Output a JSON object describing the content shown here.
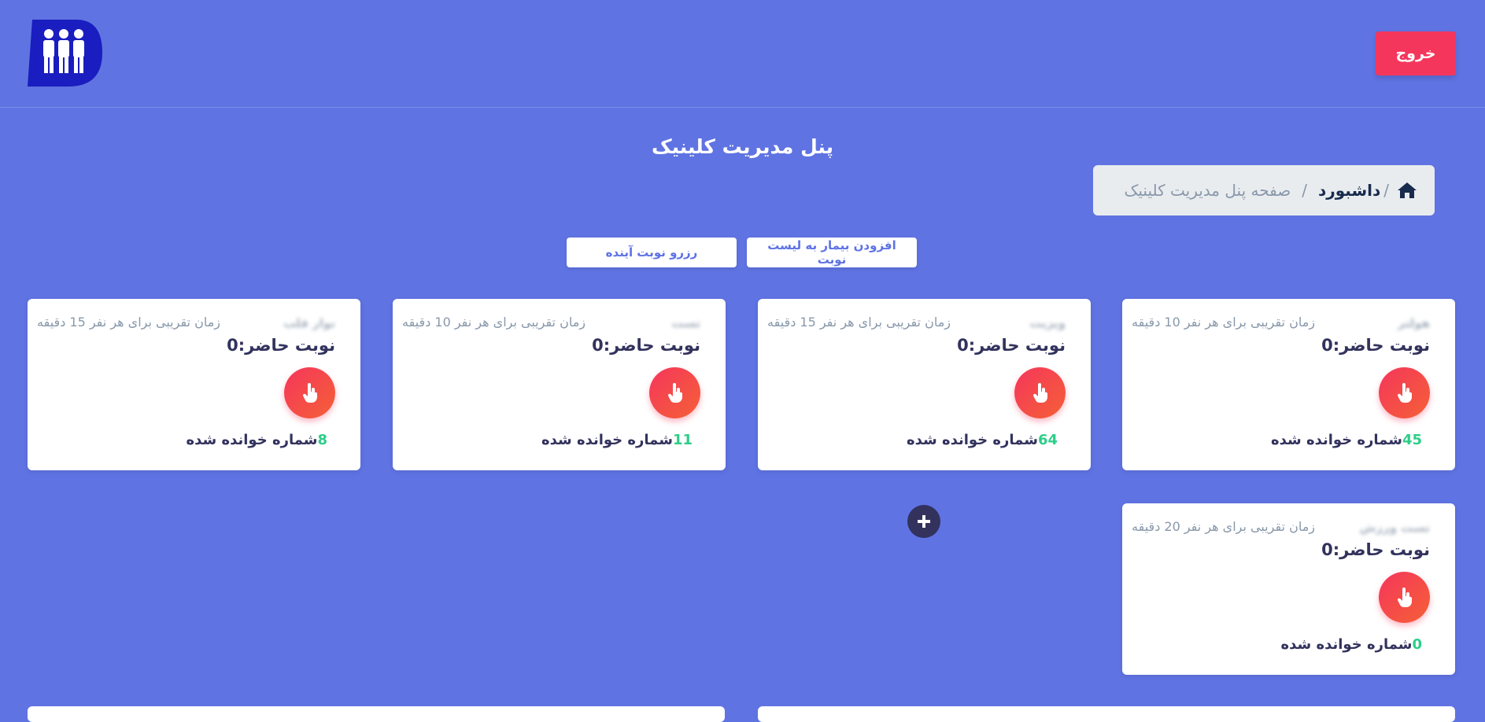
{
  "header": {
    "logo": "clinic-people-logo",
    "logout_label": "خروج"
  },
  "page_title": "پنل مدیریت کلینیک",
  "breadcrumb": {
    "home_icon": "home-icon",
    "separator": "/",
    "current": "داشبورد",
    "page": "صفحه پنل مدیریت کلینیک"
  },
  "actions": {
    "add_patient": "افزودن بیمار به لیست نوبت",
    "reserve": "رزرو نوبت آینده"
  },
  "cards": [
    {
      "name": "هولتر",
      "time": "زمان تقریبی برای هر نفر 10 دقیقه",
      "current": "نوبت حاضر:0",
      "called_count": "45",
      "called_label": "شماره خوانده شده"
    },
    {
      "name": "ویزیت",
      "time": "زمان تقریبی برای هر نفر 15 دقیقه",
      "current": "نوبت حاضر:0",
      "called_count": "64",
      "called_label": "شماره خوانده شده"
    },
    {
      "name": "تست",
      "time": "زمان تقریبی برای هر نفر 10 دقیقه",
      "current": "نوبت حاضر:0",
      "called_count": "11",
      "called_label": "شماره خوانده شده"
    },
    {
      "name": "نوار قلب",
      "time": "زمان تقریبی برای هر نفر 15 دقیقه",
      "current": "نوبت حاضر:0",
      "called_count": "8",
      "called_label": "شماره خوانده شده"
    },
    {
      "name": "تست ورزش",
      "time": "زمان تقریبی برای هر نفر 20 دقیقه",
      "current": "نوبت حاضر:0",
      "called_count": "0",
      "called_label": "شماره خوانده شده"
    }
  ],
  "colors": {
    "background": "#5f73e2",
    "danger": "#f5365c",
    "success": "#2dce89",
    "primary": "#5e72e4"
  },
  "icons": {
    "call": "hand-pointer-icon",
    "add": "plus-circle-icon"
  }
}
